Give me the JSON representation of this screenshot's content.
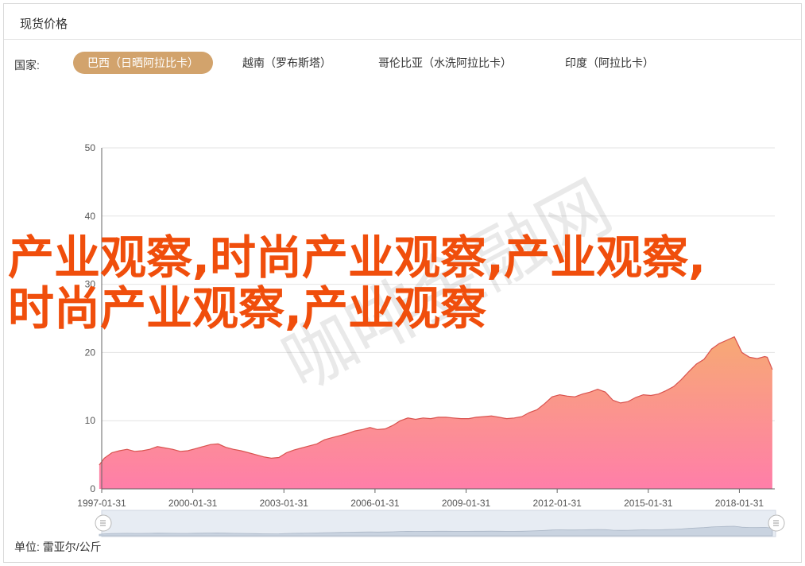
{
  "panel": {
    "title": "现货价格",
    "country_label": "国家:",
    "unit_label": "单位: 雷亚尔/公斤"
  },
  "tabs": [
    {
      "label": "巴西（日晒阿拉比卡）",
      "active": true
    },
    {
      "label": "越南（罗布斯塔）",
      "active": false
    },
    {
      "label": "哥伦比亚（水洗阿拉比卡）",
      "active": false
    },
    {
      "label": "印度（阿拉比卡）",
      "active": false
    }
  ],
  "overlay_text": "产业观察,时尚产业观察,产业观察,时尚产业观察,产业观察",
  "watermark": "咖啡金融网",
  "colors": {
    "active_tab": "#d2a36c",
    "area_top": "#f7a974",
    "area_bottom": "#ff7ea9",
    "line": "#d9534f",
    "overlay": "#f04e0c"
  },
  "chart_data": {
    "type": "area",
    "title": "",
    "xlabel": "",
    "ylabel": "",
    "ylim": [
      0,
      50
    ],
    "yticks": [
      0,
      10,
      20,
      30,
      40,
      50
    ],
    "x_range": [
      "1997-01-31",
      "2019-03-31"
    ],
    "xticks": [
      "1997-01-31",
      "2000-01-31",
      "2003-01-31",
      "2006-01-31",
      "2009-01-31",
      "2012-01-31",
      "2015-01-31",
      "2018-01-31"
    ],
    "grid": true,
    "series": [
      {
        "points": [
          [
            "1997-01",
            3.5
          ],
          [
            "1997-03",
            4.5
          ],
          [
            "1997-06",
            5.3
          ],
          [
            "1997-09",
            5.6
          ],
          [
            "1997-12",
            5.8
          ],
          [
            "1998-03",
            5.5
          ],
          [
            "1998-06",
            5.6
          ],
          [
            "1998-09",
            5.8
          ],
          [
            "1998-12",
            6.2
          ],
          [
            "1999-03",
            6.0
          ],
          [
            "1999-06",
            5.8
          ],
          [
            "1999-09",
            5.5
          ],
          [
            "1999-12",
            5.6
          ],
          [
            "2000-03",
            5.9
          ],
          [
            "2000-06",
            6.2
          ],
          [
            "2000-09",
            6.5
          ],
          [
            "2000-12",
            6.6
          ],
          [
            "2001-03",
            6.1
          ],
          [
            "2001-06",
            5.8
          ],
          [
            "2001-09",
            5.6
          ],
          [
            "2001-12",
            5.3
          ],
          [
            "2002-03",
            5.0
          ],
          [
            "2002-06",
            4.7
          ],
          [
            "2002-09",
            4.5
          ],
          [
            "2002-12",
            4.6
          ],
          [
            "2003-03",
            5.3
          ],
          [
            "2003-06",
            5.7
          ],
          [
            "2003-09",
            6.0
          ],
          [
            "2003-12",
            6.3
          ],
          [
            "2004-03",
            6.6
          ],
          [
            "2004-06",
            7.2
          ],
          [
            "2004-09",
            7.5
          ],
          [
            "2004-12",
            7.8
          ],
          [
            "2005-03",
            8.1
          ],
          [
            "2005-06",
            8.5
          ],
          [
            "2005-09",
            8.7
          ],
          [
            "2005-12",
            9.0
          ],
          [
            "2006-03",
            8.7
          ],
          [
            "2006-06",
            8.8
          ],
          [
            "2006-09",
            9.3
          ],
          [
            "2006-12",
            10.0
          ],
          [
            "2007-03",
            10.4
          ],
          [
            "2007-06",
            10.2
          ],
          [
            "2007-09",
            10.4
          ],
          [
            "2007-12",
            10.3
          ],
          [
            "2008-03",
            10.5
          ],
          [
            "2008-06",
            10.5
          ],
          [
            "2008-09",
            10.4
          ],
          [
            "2008-12",
            10.3
          ],
          [
            "2009-03",
            10.3
          ],
          [
            "2009-06",
            10.5
          ],
          [
            "2009-09",
            10.6
          ],
          [
            "2009-12",
            10.7
          ],
          [
            "2010-03",
            10.5
          ],
          [
            "2010-06",
            10.3
          ],
          [
            "2010-09",
            10.4
          ],
          [
            "2010-12",
            10.6
          ],
          [
            "2011-03",
            11.2
          ],
          [
            "2011-06",
            11.6
          ],
          [
            "2011-09",
            12.5
          ],
          [
            "2011-12",
            13.5
          ],
          [
            "2012-03",
            13.8
          ],
          [
            "2012-06",
            13.6
          ],
          [
            "2012-09",
            13.5
          ],
          [
            "2012-12",
            13.9
          ],
          [
            "2013-03",
            14.2
          ],
          [
            "2013-06",
            14.6
          ],
          [
            "2013-09",
            14.2
          ],
          [
            "2013-12",
            13.0
          ],
          [
            "2014-03",
            12.6
          ],
          [
            "2014-06",
            12.8
          ],
          [
            "2014-09",
            13.4
          ],
          [
            "2014-12",
            13.8
          ],
          [
            "2015-03",
            13.7
          ],
          [
            "2015-06",
            13.9
          ],
          [
            "2015-09",
            14.4
          ],
          [
            "2015-12",
            15.0
          ],
          [
            "2016-03",
            16.0
          ],
          [
            "2016-06",
            17.2
          ],
          [
            "2016-09",
            18.3
          ],
          [
            "2016-12",
            19.0
          ],
          [
            "2017-03",
            20.5
          ],
          [
            "2017-06",
            21.3
          ],
          [
            "2017-09",
            21.8
          ],
          [
            "2017-12",
            22.3
          ],
          [
            "2018-03",
            20.0
          ],
          [
            "2018-06",
            19.3
          ],
          [
            "2018-09",
            19.1
          ],
          [
            "2018-12",
            19.4
          ],
          [
            "2019-01",
            19.3
          ],
          [
            "2019-03",
            17.5
          ]
        ]
      }
    ]
  }
}
